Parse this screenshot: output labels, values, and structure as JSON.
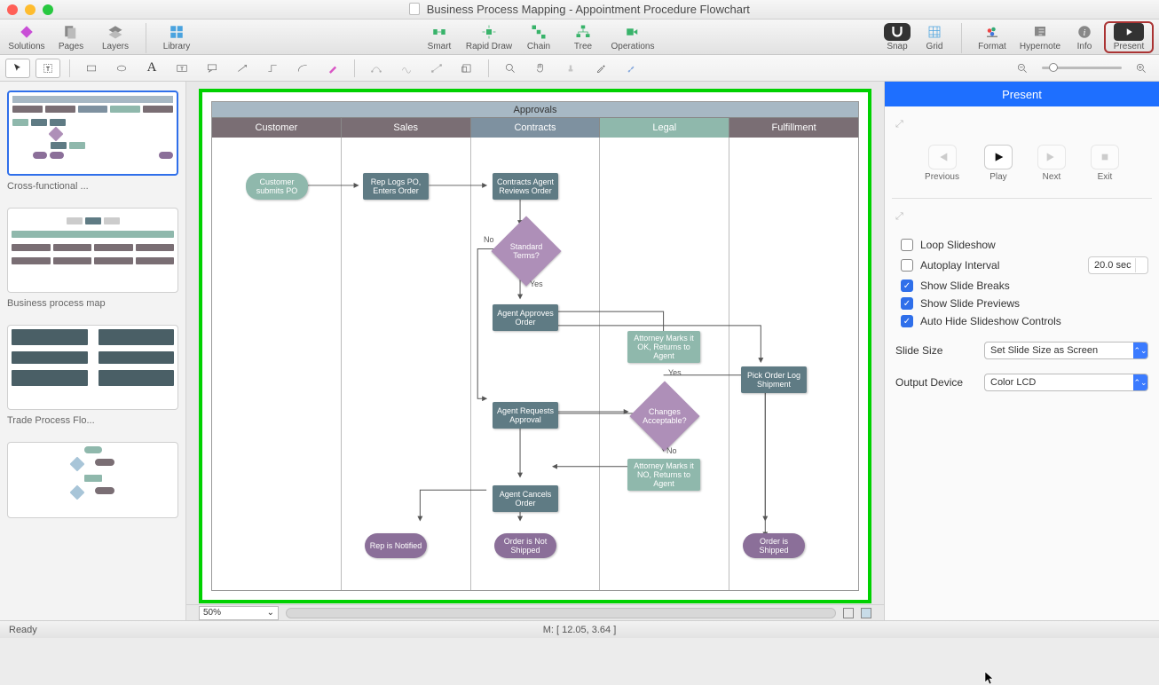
{
  "window": {
    "title": "Business Process Mapping - Appointment Procedure Flowchart"
  },
  "toolbar": {
    "solutions": "Solutions",
    "pages": "Pages",
    "layers": "Layers",
    "library": "Library",
    "smart": "Smart",
    "rapid": "Rapid Draw",
    "chain": "Chain",
    "tree": "Tree",
    "operations": "Operations",
    "snap": "Snap",
    "grid": "Grid",
    "format": "Format",
    "hypernote": "Hypernote",
    "info": "Info",
    "present": "Present"
  },
  "slides": {
    "items": [
      {
        "caption": "Cross-functional ..."
      },
      {
        "caption": "Business process map"
      },
      {
        "caption": "Trade Process Flo..."
      },
      {
        "caption": ""
      }
    ]
  },
  "diagram": {
    "title": "Approvals",
    "columns": {
      "customer": "Customer",
      "sales": "Sales",
      "contracts": "Contracts",
      "legal": "Legal",
      "fulfillment": "Fulfillment"
    },
    "nodes": {
      "cust_submits": "Customer submits PO",
      "rep_logs": "Rep Logs PO, Enters Order",
      "agent_reviews": "Contracts Agent Reviews Order",
      "std_terms": "Standard Terms?",
      "agent_approves": "Agent Approves Order",
      "attorney_ok": "Attorney Marks it OK, Returns to Agent",
      "changes_acc": "Changes Acceptable?",
      "attorney_no": "Attorney Marks it NO, Returns to Agent",
      "agent_requests": "Agent Requests Approval",
      "agent_cancels": "Agent Cancels Order",
      "pick_order": "Pick Order Log Shipment",
      "rep_notified": "Rep is Notified",
      "order_not_shipped": "Order is Not Shipped",
      "order_shipped": "Order is Shipped"
    },
    "labels": {
      "no": "No",
      "yes": "Yes",
      "yes2": "Yes",
      "no2": "No"
    }
  },
  "present": {
    "header": "Present",
    "previous": "Previous",
    "play": "Play",
    "next": "Next",
    "exit": "Exit",
    "loop": "Loop Slideshow",
    "autoplay": "Autoplay Interval",
    "interval": "20.0 sec",
    "show_breaks": "Show Slide Breaks",
    "show_previews": "Show Slide Previews",
    "autohide": "Auto Hide Slideshow Controls",
    "slide_size_label": "Slide Size",
    "slide_size_value": "Set Slide Size as Screen",
    "output_label": "Output Device",
    "output_value": "Color LCD"
  },
  "canvas": {
    "zoom": "50%"
  },
  "status": {
    "ready": "Ready",
    "mouse": "M: [ 12.05, 3.64 ]"
  }
}
